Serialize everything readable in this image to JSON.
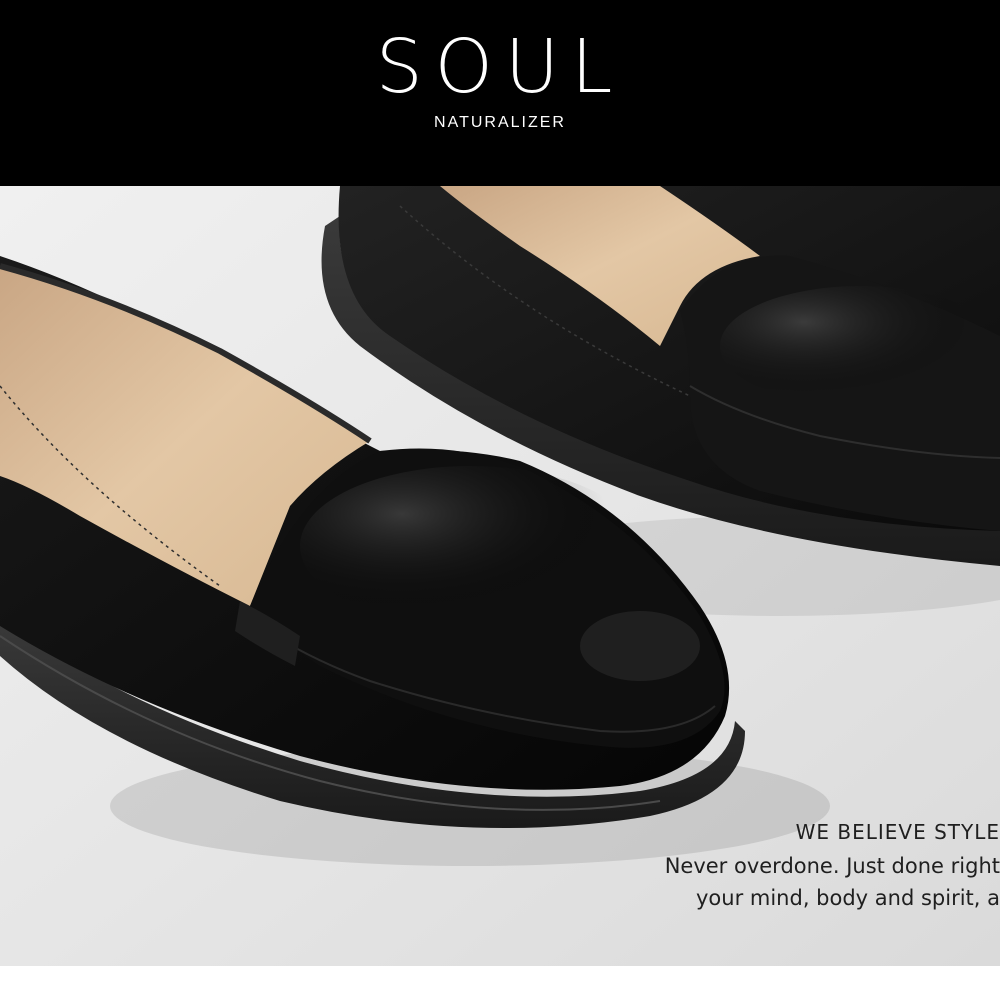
{
  "brand": {
    "title": "SOUL",
    "subtitle": "NATURALIZER"
  },
  "tagline": {
    "heading": "WE BELIEVE STYLE",
    "line1": "Never overdone. Just done right",
    "line2": "your mind, body and spirit, a"
  },
  "colors": {
    "header_bg": "#000000",
    "header_text": "#ffffff",
    "background": "#e4e4e4",
    "shoe_leather": "#121212",
    "shoe_lining": "#d9b995",
    "tagline_text": "#1f1f1f"
  },
  "image": {
    "subject": "black leather loafers"
  }
}
